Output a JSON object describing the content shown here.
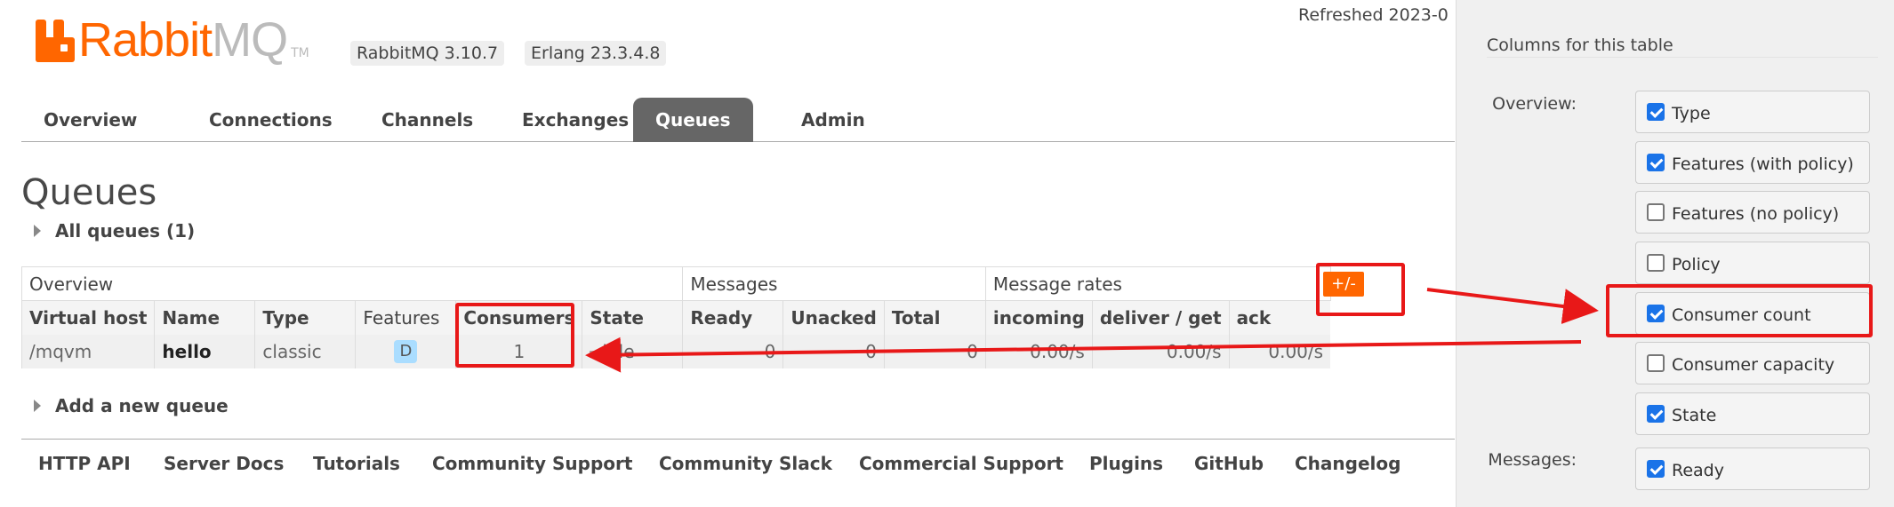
{
  "logo": {
    "rabbit": "Rabbit",
    "mq": "MQ",
    "tm": "TM"
  },
  "header": {
    "rabbitmq_version": "RabbitMQ 3.10.7",
    "erlang_version": "Erlang 23.3.4.8",
    "refreshed": "Refreshed 2023-0"
  },
  "tabs": [
    "Overview",
    "Connections",
    "Channels",
    "Exchanges",
    "Queues",
    "Admin"
  ],
  "active_tab": "Queues",
  "page_title": "Queues",
  "all_queues": "All queues (1)",
  "table": {
    "groups": [
      "Overview",
      "Messages",
      "Message rates"
    ],
    "plus_minus": "+/-",
    "columns": [
      "Virtual host",
      "Name",
      "Type",
      "Features",
      "Consumers",
      "State",
      "Ready",
      "Unacked",
      "Total",
      "incoming",
      "deliver / get",
      "ack"
    ],
    "rows": [
      {
        "vhost": "/mqvm",
        "name": "hello",
        "type": "classic",
        "features": "D",
        "consumers": "1",
        "state": "idle",
        "ready": "0",
        "unacked": "0",
        "total": "0",
        "incoming": "0.00/s",
        "deliver_get": "0.00/s",
        "ack": "0.00/s"
      }
    ]
  },
  "add_queue": "Add a new queue",
  "footer": [
    "HTTP API",
    "Server Docs",
    "Tutorials",
    "Community Support",
    "Community Slack",
    "Commercial Support",
    "Plugins",
    "GitHub",
    "Changelog"
  ],
  "panel": {
    "title": "Columns for this table",
    "overview_label": "Overview:",
    "messages_label": "Messages:",
    "options": [
      {
        "label": "Type",
        "checked": true
      },
      {
        "label": "Features (with policy)",
        "checked": true
      },
      {
        "label": "Features (no policy)",
        "checked": false
      },
      {
        "label": "Policy",
        "checked": false
      },
      {
        "label": "Consumer count",
        "checked": true
      },
      {
        "label": "Consumer capacity",
        "checked": false
      },
      {
        "label": "State",
        "checked": true
      },
      {
        "label": "Ready",
        "checked": true
      }
    ]
  },
  "colors": {
    "accent": "#ff6600",
    "annotation": "#e81818",
    "active_tab": "#666666",
    "feature_badge": "#aaddff"
  }
}
